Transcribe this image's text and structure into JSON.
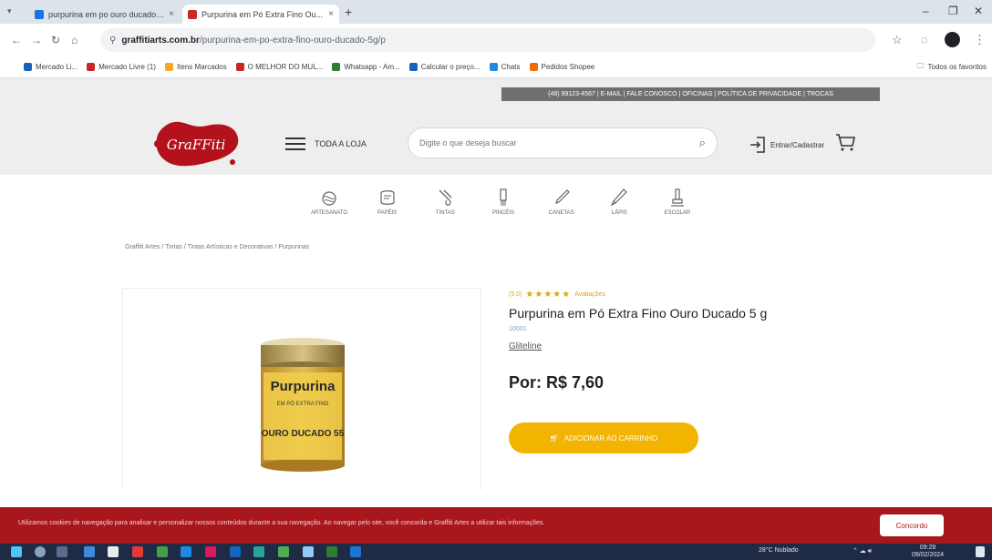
{
  "browser": {
    "tabs": [
      {
        "title": "purpurina em po ouro ducado gra...",
        "active": false,
        "favicon_color": "#1a73e8"
      },
      {
        "title": "Purpurina em Pó Extra Fino Ou...",
        "active": true,
        "favicon_color": "#c62828"
      }
    ],
    "url_host": "graffitiarts.com.br",
    "url_path": "/purpurina-em-po-extra-fino-ouro-ducado-5g/p",
    "bookmarks": [
      {
        "label": "Mercado Li...",
        "color": "#1565c0"
      },
      {
        "label": "Mercado Livre (1)",
        "color": "#c62828"
      },
      {
        "label": "Itens Marcados",
        "color": "#f9a825"
      },
      {
        "label": "O MELHOR DO MUL...",
        "color": "#c62828"
      },
      {
        "label": "Whatsapp - Am...",
        "color": "#2e7d32"
      },
      {
        "label": "Calcular o preço...",
        "color": "#1565c0"
      },
      {
        "label": "Chats",
        "color": "#1e88e5"
      },
      {
        "label": "Pedidos Shopee",
        "color": "#ef6c00"
      }
    ],
    "other_bookmarks": "Todos os favoritos"
  },
  "site": {
    "topbar_text": "(48) 99123-4567 | E-MAIL | FALE CONOSCO | OFICINAS | POLÍTICA DE PRIVACIDADE | TROCAS",
    "logo_text": "GraFFiti",
    "menu_label": "TODA A LOJA",
    "search_placeholder": "Digite o que deseja buscar",
    "login_label": "Entrar/Cadastrar",
    "categories": [
      {
        "label": "ARTESANATO",
        "icon": "yarn-icon"
      },
      {
        "label": "PAPÉIS",
        "icon": "paper-icon"
      },
      {
        "label": "TINTAS",
        "icon": "paint-icon"
      },
      {
        "label": "PINCÉIS",
        "icon": "brush-icon"
      },
      {
        "label": "CANETAS",
        "icon": "pen-icon"
      },
      {
        "label": "LÁPIS",
        "icon": "pencil-icon"
      },
      {
        "label": "ESCOLAR",
        "icon": "school-icon"
      }
    ],
    "breadcrumb": "Graffiti Artes / Tintas / Tintas Artísticas e Decorativas / Purpurinas"
  },
  "product": {
    "rating_label": "(5.0)",
    "stars": "★★★★★",
    "reviews": "Avaliações",
    "title": "Purpurina em Pó Extra Fino Ouro Ducado 5 g",
    "sku": "10001",
    "brand": "Gliteline",
    "price": "Por: R$ 7,60",
    "buy_label": "ADICIONAR AO CARRINHO",
    "jar_label_main": "Purpurina",
    "jar_label_sub": "EM PÓ EXTRA FINO",
    "jar_label_color": "OURO DUCADO 55"
  },
  "cookie": {
    "text": "Utilizamos cookies de navegação para analisar e personalizar nossos conteúdos durante a sua navegação. Ao navegar pelo site, você concorda e Graffiti Artes a utilizar tais informações.",
    "button": "Concordo"
  },
  "taskbar": {
    "weather": "28°C Nublado",
    "time": "09:28",
    "date": "09/02/2024"
  },
  "colors": {
    "brand_red": "#a8171c",
    "buy_yellow": "#f2b400",
    "star_gold": "#e0a800"
  }
}
